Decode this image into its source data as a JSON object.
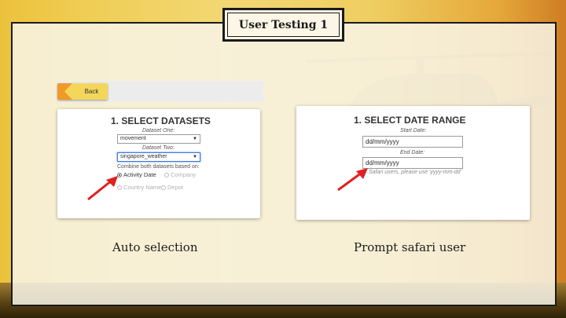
{
  "slide": {
    "title": "User Testing 1"
  },
  "left_panel": {
    "back_label": "Back",
    "heading": "1. SELECT DATASETS",
    "dataset_one_label": "Dataset One:",
    "dataset_one_value": "movement",
    "dataset_two_label": "Dataset Two:",
    "dataset_two_value": "singapore_weather",
    "combine_label": "Combine both datasets based on:",
    "radio_options": [
      {
        "label": "Activity Date",
        "selected": true
      },
      {
        "label": "Company",
        "selected": false
      },
      {
        "label": "Country Name",
        "selected": false
      },
      {
        "label": "Depot",
        "selected": false
      }
    ],
    "caption": "Auto selection"
  },
  "right_panel": {
    "heading": "1. SELECT DATE RANGE",
    "start_label": "Start Date:",
    "start_value": "dd/mm/yyyy",
    "end_label": "End Date:",
    "end_value": "dd/mm/yyyy",
    "safari_note": "Safari users, please use 'yyyy-mm-dd'",
    "caption": "Prompt safari user"
  },
  "colors": {
    "back_button": "#f19a26",
    "back_inner": "#f4d75a",
    "arrow": "#e02020",
    "active_select_border": "#3d7bd8"
  }
}
